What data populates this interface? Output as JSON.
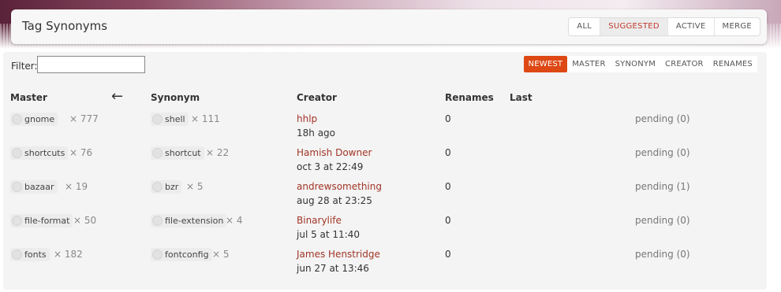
{
  "header": {
    "title": "Tag Synonyms",
    "tabs": [
      {
        "label": "ALL",
        "selected": false
      },
      {
        "label": "SUGGESTED",
        "selected": true
      },
      {
        "label": "ACTIVE",
        "selected": false
      },
      {
        "label": "MERGE",
        "selected": false
      }
    ]
  },
  "filter": {
    "label": "Filter:",
    "value": ""
  },
  "sort_tabs": [
    {
      "label": "NEWEST",
      "selected": true
    },
    {
      "label": "MASTER",
      "selected": false
    },
    {
      "label": "SYNONYM",
      "selected": false
    },
    {
      "label": "CREATOR",
      "selected": false
    },
    {
      "label": "RENAMES",
      "selected": false
    }
  ],
  "columns": {
    "master": "Master",
    "arrow": "←",
    "synonym": "Synonym",
    "creator": "Creator",
    "renames": "Renames",
    "last": "Last"
  },
  "rows": [
    {
      "master": "gnome",
      "master_count": "× 777",
      "synonym": "shell",
      "synonym_count": "× 111",
      "creator": "hhlp",
      "time": "18h ago",
      "renames": "0",
      "status": "pending (0)"
    },
    {
      "master": "shortcuts",
      "master_count": "× 76",
      "synonym": "shortcut",
      "synonym_count": "× 22",
      "creator": "Hamish Downer",
      "time": "oct 3 at 22:49",
      "renames": "0",
      "status": "pending (0)"
    },
    {
      "master": "bazaar",
      "master_count": "× 19",
      "synonym": "bzr",
      "synonym_count": "× 5",
      "creator": "andrewsomething",
      "time": "aug 28 at 23:25",
      "renames": "0",
      "status": "pending (1)"
    },
    {
      "master": "file-format",
      "master_count": "× 50",
      "synonym": "file-extension",
      "synonym_count": "× 4",
      "creator": "Binarylife",
      "time": "jul 5 at 11:40",
      "renames": "0",
      "status": "pending (0)"
    },
    {
      "master": "fonts",
      "master_count": "× 182",
      "synonym": "fontconfig",
      "synonym_count": "× 5",
      "creator": "James Henstridge",
      "time": "jun 27 at 13:46",
      "renames": "0",
      "status": "pending (0)"
    }
  ],
  "colors": {
    "accent": "#dd4814",
    "link": "#a03526",
    "selected_tab_text": "#c0392b"
  }
}
